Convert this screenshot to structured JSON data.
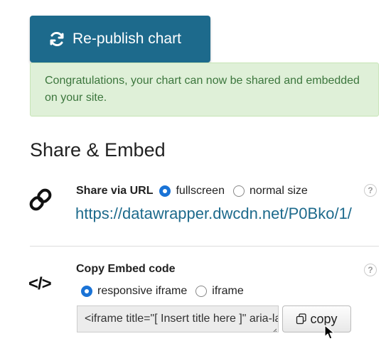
{
  "republish": {
    "label": "Re-publish chart",
    "icon": "refresh-icon"
  },
  "alert": {
    "message": "Congratulations, your chart can now be shared and embedded on your site."
  },
  "section": {
    "title": "Share & Embed"
  },
  "share_url": {
    "label": "Share via URL",
    "options": [
      {
        "label": "fullscreen",
        "checked": true
      },
      {
        "label": "normal size",
        "checked": false
      }
    ],
    "url": "https://datawrapper.dwcdn.net/P0Bko/1/",
    "help": "?",
    "icon": "link-icon"
  },
  "embed": {
    "label": "Copy Embed code",
    "options": [
      {
        "label": "responsive iframe",
        "checked": true
      },
      {
        "label": "iframe",
        "checked": false
      }
    ],
    "code": "<iframe title=\"[ Insert title here ]\" aria-label=\"Bar Chart\"",
    "copy_label": "copy",
    "help": "?",
    "icon": "code-icon"
  },
  "colors": {
    "primary_button": "#1d6a8c",
    "success_bg": "#dff0d8",
    "success_text": "#3c763d",
    "link": "#1d6a8c",
    "radio_checked": "#1a73d6"
  }
}
